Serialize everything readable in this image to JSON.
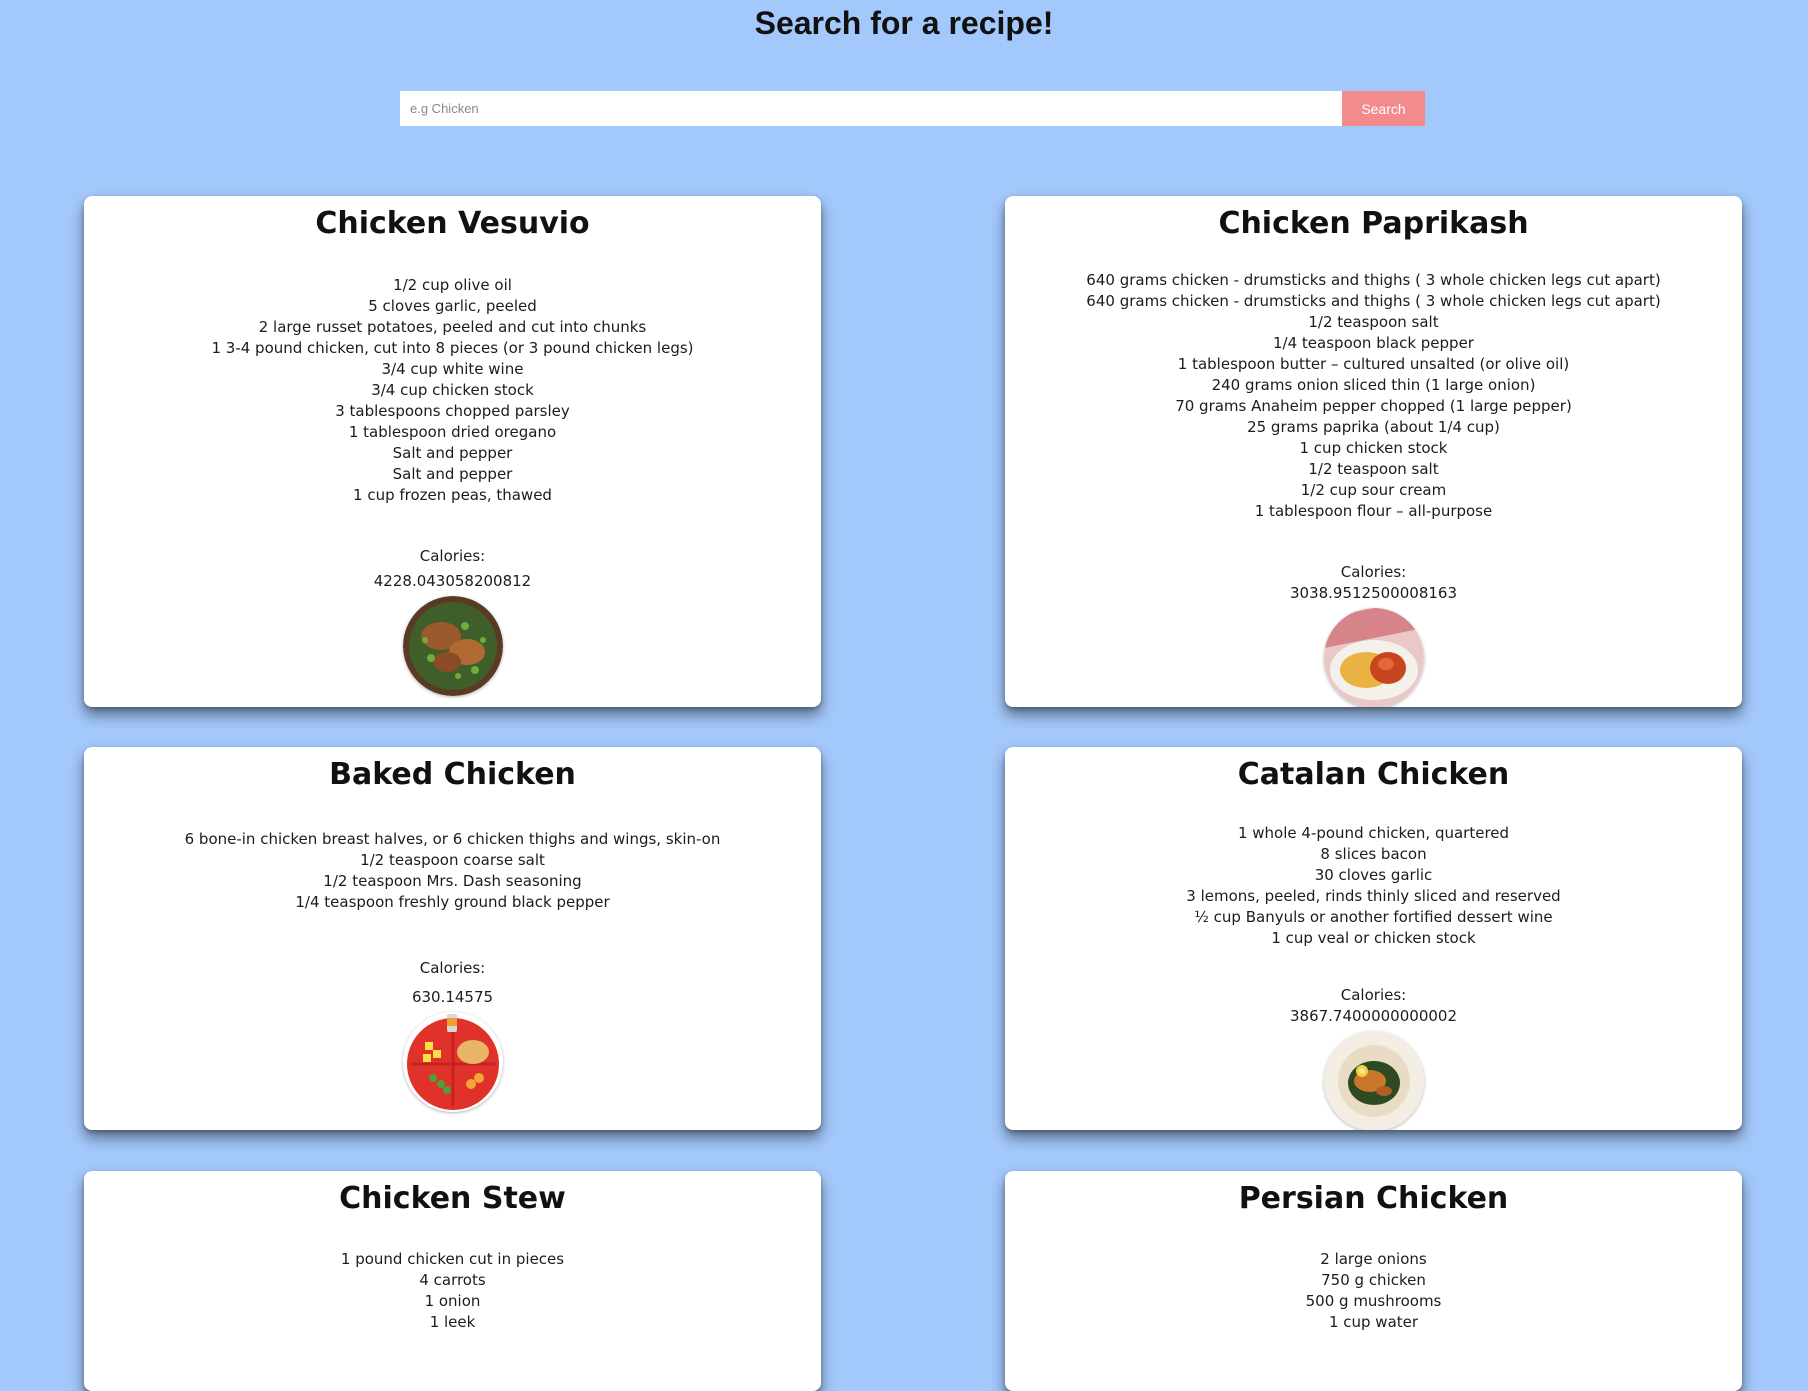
{
  "header": {
    "title": "Search for a recipe!"
  },
  "search": {
    "placeholder": "e.g Chicken",
    "value": "",
    "button_label": "Search"
  },
  "calories_label": "Calories:",
  "recipes": [
    {
      "title": "Chicken Vesuvio",
      "ingredients": [
        "1/2 cup olive oil",
        "5 cloves garlic, peeled",
        "2 large russet potatoes, peeled and cut into chunks",
        "1 3-4 pound chicken, cut into 8 pieces (or 3 pound chicken legs)",
        "3/4 cup white wine",
        "3/4 cup chicken stock",
        "3 tablespoons chopped parsley",
        "1 tablespoon dried oregano",
        "Salt and pepper",
        "Salt and pepper",
        "1 cup frozen peas, thawed"
      ],
      "calories": "4228.043058200812",
      "image": "chicken-vesuvio-dish-icon"
    },
    {
      "title": "Chicken Paprikash",
      "ingredients": [
        "640 grams chicken - drumsticks and thighs ( 3 whole chicken legs cut apart)",
        "640 grams chicken - drumsticks and thighs ( 3 whole chicken legs cut apart)",
        "1/2 teaspoon salt",
        "1/4 teaspoon black pepper",
        "1 tablespoon butter – cultured unsalted (or olive oil)",
        "240 grams onion sliced thin (1 large onion)",
        "70 grams Anaheim pepper chopped (1 large pepper)",
        "25 grams paprika (about 1/4 cup)",
        "1 cup chicken stock",
        "1/2 teaspoon salt",
        "1/2 cup sour cream",
        "1 tablespoon flour – all-purpose"
      ],
      "calories": "3038.9512500008163",
      "image": "chicken-paprikash-dish-icon"
    },
    {
      "title": "Baked Chicken",
      "ingredients": [
        "6 bone-in chicken breast halves, or 6 chicken thighs and wings, skin-on",
        "1/2 teaspoon coarse salt",
        "1/2 teaspoon Mrs. Dash seasoning",
        "1/4 teaspoon freshly ground black pepper"
      ],
      "calories": "630.14575",
      "image": "baked-chicken-dish-icon"
    },
    {
      "title": "Catalan Chicken",
      "ingredients": [
        "1 whole 4-pound chicken, quartered",
        "8 slices bacon",
        "30 cloves garlic",
        "3 lemons, peeled, rinds thinly sliced and reserved",
        "½ cup Banyuls or another fortified dessert wine",
        "1 cup veal or chicken stock"
      ],
      "calories": "3867.7400000000002",
      "image": "catalan-chicken-dish-icon"
    },
    {
      "title": "Chicken Stew",
      "ingredients": [
        "1 pound chicken cut in pieces",
        "4 carrots",
        "1 onion",
        "1 leek"
      ],
      "calories": "",
      "image": ""
    },
    {
      "title": "Persian Chicken",
      "ingredients": [
        "2 large onions",
        "750 g chicken",
        "500 g mushrooms",
        "1 cup water"
      ],
      "calories": "",
      "image": ""
    }
  ]
}
